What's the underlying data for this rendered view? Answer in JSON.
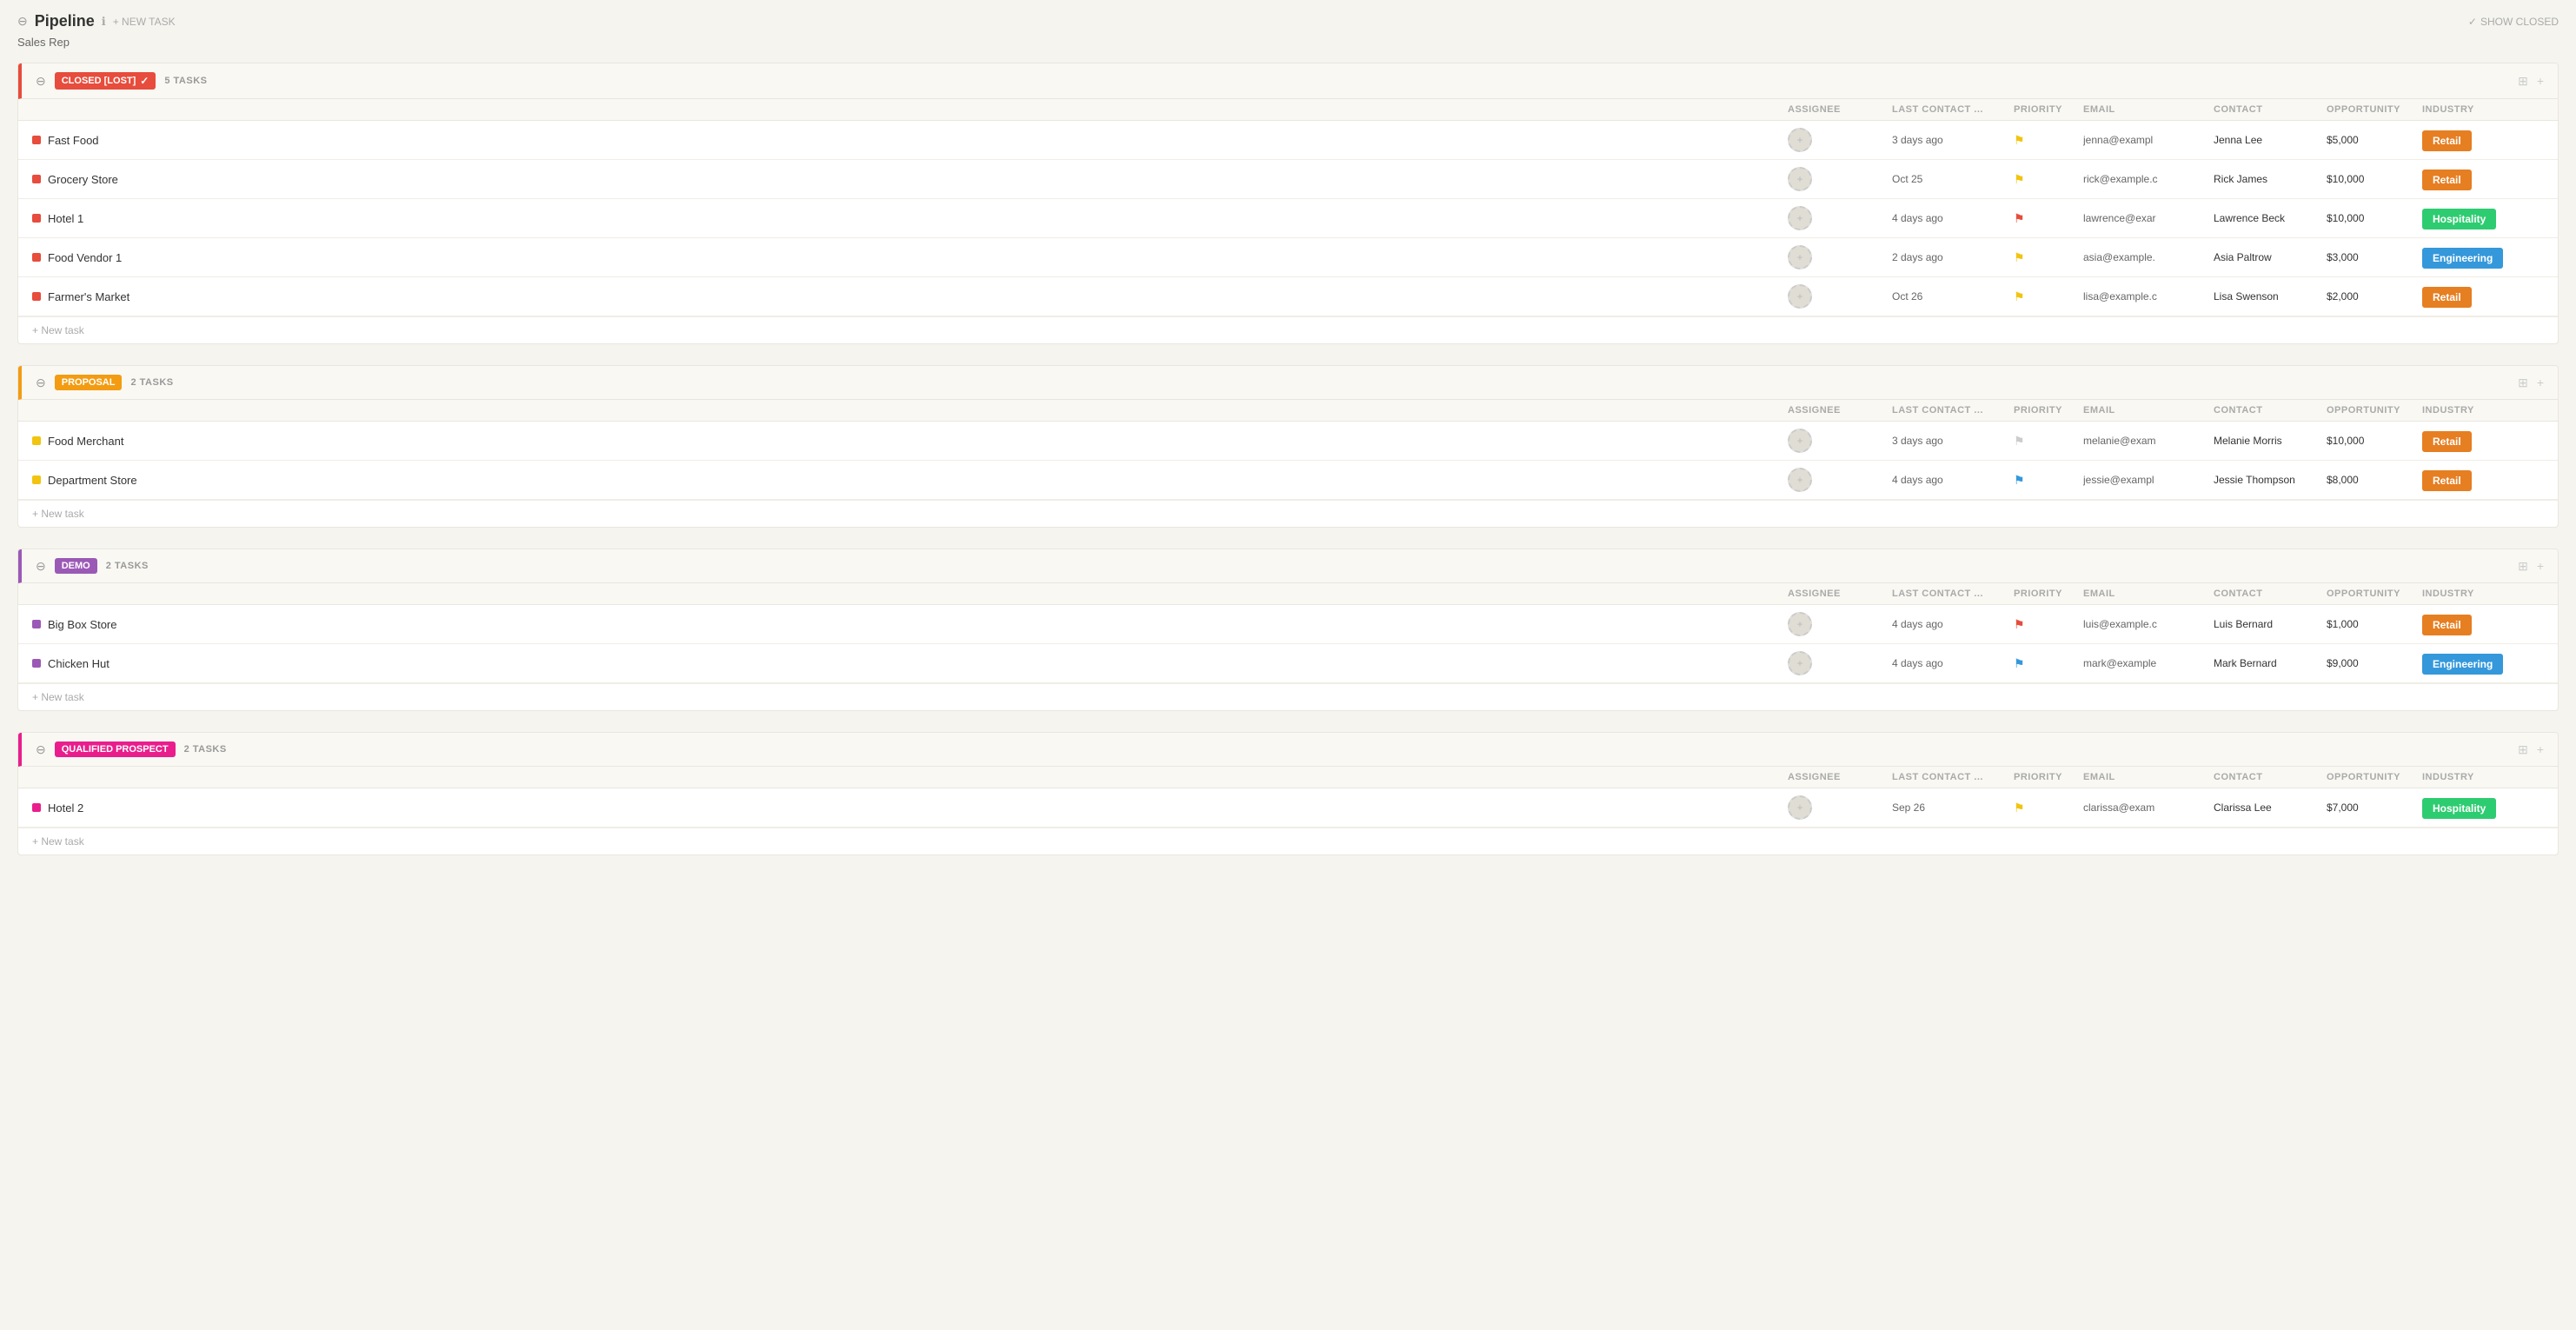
{
  "header": {
    "title": "Pipeline",
    "new_task_label": "+ NEW TASK",
    "show_closed_label": "SHOW CLOSED",
    "subtitle": "Sales Rep"
  },
  "sections": [
    {
      "id": "closed-lost",
      "badge_label": "CLOSED [LOST]",
      "badge_class": "badge-closed-lost",
      "header_class": "closed-lost",
      "task_count": "5 TASKS",
      "dot_class": "dot-red",
      "columns": [
        "ASSIGNEE",
        "LAST CONTACT ...",
        "PRIORITY",
        "EMAIL",
        "CONTACT",
        "OPPORTUNITY",
        "INDUSTRY"
      ],
      "tasks": [
        {
          "name": "Fast Food",
          "last_contact": "3 days ago",
          "priority": "yellow",
          "email": "jenna@exampl",
          "contact": "Jenna Lee",
          "opportunity": "$5,000",
          "industry": "Retail",
          "industry_class": "ind-retail"
        },
        {
          "name": "Grocery Store",
          "last_contact": "Oct 25",
          "priority": "yellow",
          "email": "rick@example.c",
          "contact": "Rick James",
          "opportunity": "$10,000",
          "industry": "Retail",
          "industry_class": "ind-retail"
        },
        {
          "name": "Hotel 1",
          "last_contact": "4 days ago",
          "priority": "red",
          "email": "lawrence@exar",
          "contact": "Lawrence Beck",
          "opportunity": "$10,000",
          "industry": "Hospitality",
          "industry_class": "ind-hospitality"
        },
        {
          "name": "Food Vendor 1",
          "last_contact": "2 days ago",
          "priority": "yellow",
          "email": "asia@example.",
          "contact": "Asia Paltrow",
          "opportunity": "$3,000",
          "industry": "Engineering",
          "industry_class": "ind-engineering"
        },
        {
          "name": "Farmer's Market",
          "last_contact": "Oct 26",
          "priority": "yellow",
          "email": "lisa@example.c",
          "contact": "Lisa Swenson",
          "opportunity": "$2,000",
          "industry": "Retail",
          "industry_class": "ind-retail"
        }
      ]
    },
    {
      "id": "proposal",
      "badge_label": "PROPOSAL",
      "badge_class": "badge-proposal",
      "header_class": "proposal",
      "task_count": "2 TASKS",
      "dot_class": "dot-yellow",
      "columns": [
        "ASSIGNEE",
        "LAST CONTACT ...",
        "PRIORITY",
        "EMAIL",
        "CONTACT",
        "OPPORTUNITY",
        "INDUSTRY"
      ],
      "tasks": [
        {
          "name": "Food Merchant",
          "last_contact": "3 days ago",
          "priority": "gray",
          "email": "melanie@exam",
          "contact": "Melanie Morris",
          "opportunity": "$10,000",
          "industry": "Retail",
          "industry_class": "ind-retail"
        },
        {
          "name": "Department Store",
          "last_contact": "4 days ago",
          "priority": "blue",
          "email": "jessie@exampl",
          "contact": "Jessie Thompson",
          "opportunity": "$8,000",
          "industry": "Retail",
          "industry_class": "ind-retail"
        }
      ]
    },
    {
      "id": "demo",
      "badge_label": "DEMO",
      "badge_class": "badge-demo",
      "header_class": "demo",
      "task_count": "2 TASKS",
      "dot_class": "dot-purple",
      "columns": [
        "ASSIGNEE",
        "LAST CONTACT ...",
        "PRIORITY",
        "EMAIL",
        "CONTACT",
        "OPPORTUNITY",
        "INDUSTRY"
      ],
      "tasks": [
        {
          "name": "Big Box Store",
          "last_contact": "4 days ago",
          "priority": "red",
          "email": "luis@example.c",
          "contact": "Luis Bernard",
          "opportunity": "$1,000",
          "industry": "Retail",
          "industry_class": "ind-retail"
        },
        {
          "name": "Chicken Hut",
          "last_contact": "4 days ago",
          "priority": "blue",
          "email": "mark@example",
          "contact": "Mark Bernard",
          "opportunity": "$9,000",
          "industry": "Engineering",
          "industry_class": "ind-engineering"
        }
      ]
    },
    {
      "id": "qualified",
      "badge_label": "QUALIFIED PROSPECT",
      "badge_class": "badge-qualified",
      "header_class": "qualified",
      "task_count": "2 TASKS",
      "dot_class": "dot-pink",
      "columns": [
        "ASSIGNEE",
        "LAST CONTACT ...",
        "PRIORITY",
        "EMAIL",
        "CONTACT",
        "OPPORTUNITY",
        "INDUSTRY"
      ],
      "tasks": [
        {
          "name": "Hotel 2",
          "last_contact": "Sep 26",
          "priority": "yellow",
          "email": "clarissa@exam",
          "contact": "Clarissa Lee",
          "opportunity": "$7,000",
          "industry": "Hospitality",
          "industry_class": "ind-hospitality"
        }
      ]
    }
  ],
  "new_task_label": "+ New task",
  "columns": {
    "assignee": "ASSIGNEE",
    "last_contact": "LAST CONTACT ...",
    "priority": "PRIORITY",
    "email": "EMAIL",
    "contact": "CONTACT",
    "opportunity": "OPPORTUNITY",
    "industry": "INDUSTRY"
  }
}
